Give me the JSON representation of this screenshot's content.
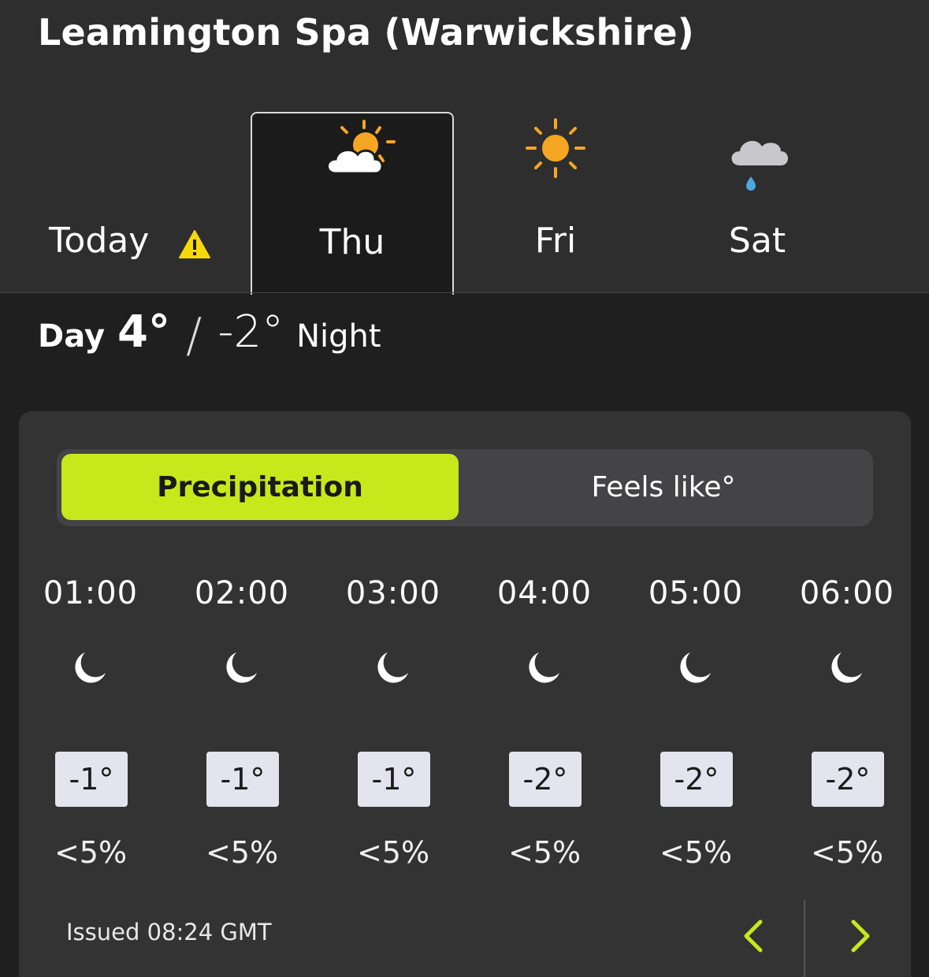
{
  "location": "Leamington Spa (Warwickshire)",
  "days": [
    {
      "label": "Today",
      "icon": "warning-icon",
      "selected": false
    },
    {
      "label": "Thu",
      "icon": "sun-behind-cloud-icon",
      "selected": true
    },
    {
      "label": "Fri",
      "icon": "sun-icon",
      "selected": false
    },
    {
      "label": "Sat",
      "icon": "cloud-rain-icon",
      "selected": false
    }
  ],
  "summary": {
    "day_word": "Day",
    "day_temp": "4°",
    "slash": "/",
    "night_temp": "-2°",
    "night_word": "Night"
  },
  "toggle": {
    "precipitation": "Precipitation",
    "feels_like": "Feels like°",
    "active": "precipitation"
  },
  "hours": [
    {
      "time": "01:00",
      "icon": "moon-icon",
      "temp": "-1°",
      "precip": "<5%"
    },
    {
      "time": "02:00",
      "icon": "moon-icon",
      "temp": "-1°",
      "precip": "<5%"
    },
    {
      "time": "03:00",
      "icon": "moon-icon",
      "temp": "-1°",
      "precip": "<5%"
    },
    {
      "time": "04:00",
      "icon": "moon-icon",
      "temp": "-2°",
      "precip": "<5%"
    },
    {
      "time": "05:00",
      "icon": "moon-icon",
      "temp": "-2°",
      "precip": "<5%"
    },
    {
      "time": "06:00",
      "icon": "moon-icon",
      "temp": "-2°",
      "precip": "<5%"
    }
  ],
  "issued": "Issued 08:24 GMT",
  "colors": {
    "accent": "#c7e81a",
    "sun": "#f5a623",
    "rain": "#4aa8e0",
    "warning": "#f5d90a"
  }
}
